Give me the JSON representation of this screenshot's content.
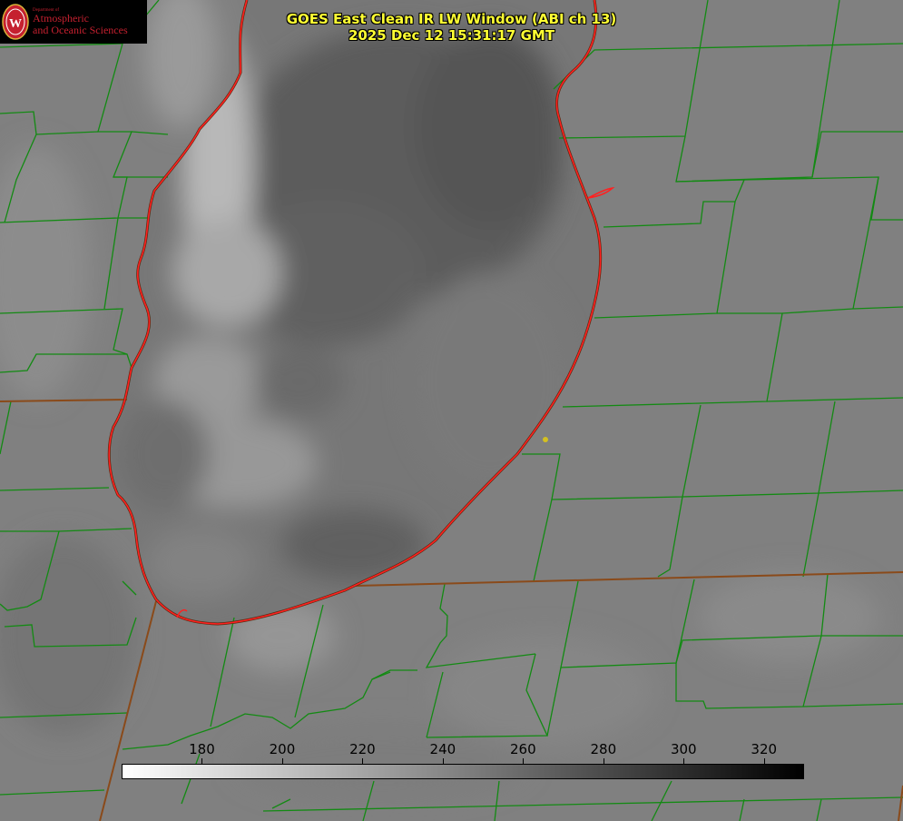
{
  "logo": {
    "department": "Department of",
    "line1": "Atmospheric",
    "line2": "and Oceanic Sciences"
  },
  "title": {
    "line1": "GOES East Clean IR LW Window (ABI ch 13)",
    "line2": "2025 Dec 12 15:31:17 GMT"
  },
  "colorbar": {
    "min": 160,
    "max": 330,
    "ticks": [
      "180",
      "200",
      "220",
      "240",
      "260",
      "280",
      "300",
      "320"
    ],
    "gradient": [
      "#ffffff",
      "#000000"
    ]
  },
  "colors": {
    "county_lines": "#138a13",
    "state_lines": "#8a4a1a",
    "lake_shoreline": "#ff2020",
    "marker": "#d4c020",
    "title_text": "#ffff33",
    "logo_text": "#c5202f"
  }
}
